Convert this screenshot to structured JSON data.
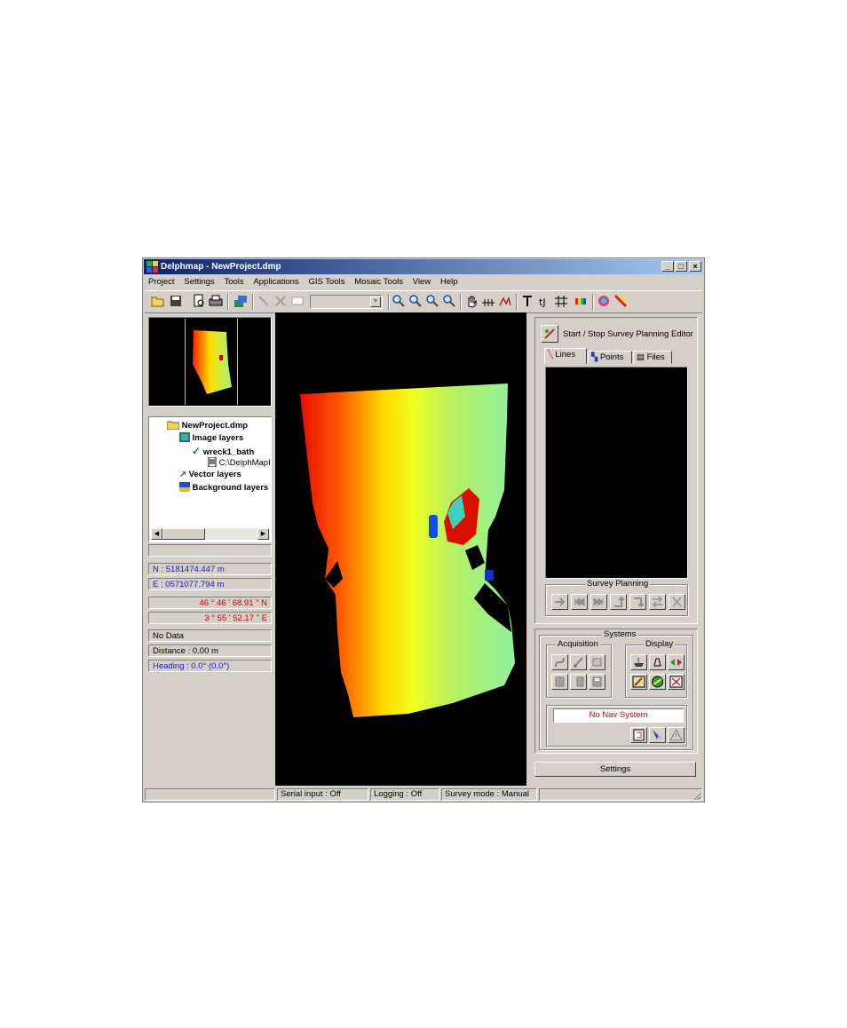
{
  "window": {
    "title": "Delphmap - NewProject.dmp"
  },
  "menu": [
    "Project",
    "Settings",
    "Tools",
    "Applications",
    "GIS Tools",
    "Mosaic Tools",
    "View",
    "Help"
  ],
  "tree": {
    "root": "NewProject.dmp",
    "image_layers": "Image layers",
    "layer": "wreck1_bath",
    "file": "C:\\DelphMapI",
    "vector_layers": "Vector layers",
    "background_layers": "Background layers"
  },
  "coords": {
    "north": "N : 5181474.447 m",
    "east": "E : 0571077.794 m",
    "lat": "46 ° 46 ' 68.91 \" N",
    "lon": "3 ° 55 ' 52.17 \" E"
  },
  "info": {
    "value": "No Data",
    "distance": "Distance : 0.00 m",
    "heading": "Heading : 0.0° (0.0°)"
  },
  "survey": {
    "editor_label": "Start / Stop Survey Planning Editor",
    "tabs": [
      "Lines",
      "Points",
      "Files"
    ],
    "planning_label": "Survey Planning"
  },
  "systems": {
    "label": "Systems",
    "acquisition": "Acquisition",
    "display": "Display",
    "nav_status": "No Nav System",
    "settings": "Settings"
  },
  "status": {
    "serial": "Serial input : Off",
    "logging": "Logging : Off",
    "mode": "Survey mode : Manual"
  },
  "colors": {
    "title_start": "#0a246a",
    "title_end": "#a6caf0",
    "coord_blue": "#1a1ad0",
    "coord_red": "#d00000",
    "nav_red": "#d00000"
  }
}
